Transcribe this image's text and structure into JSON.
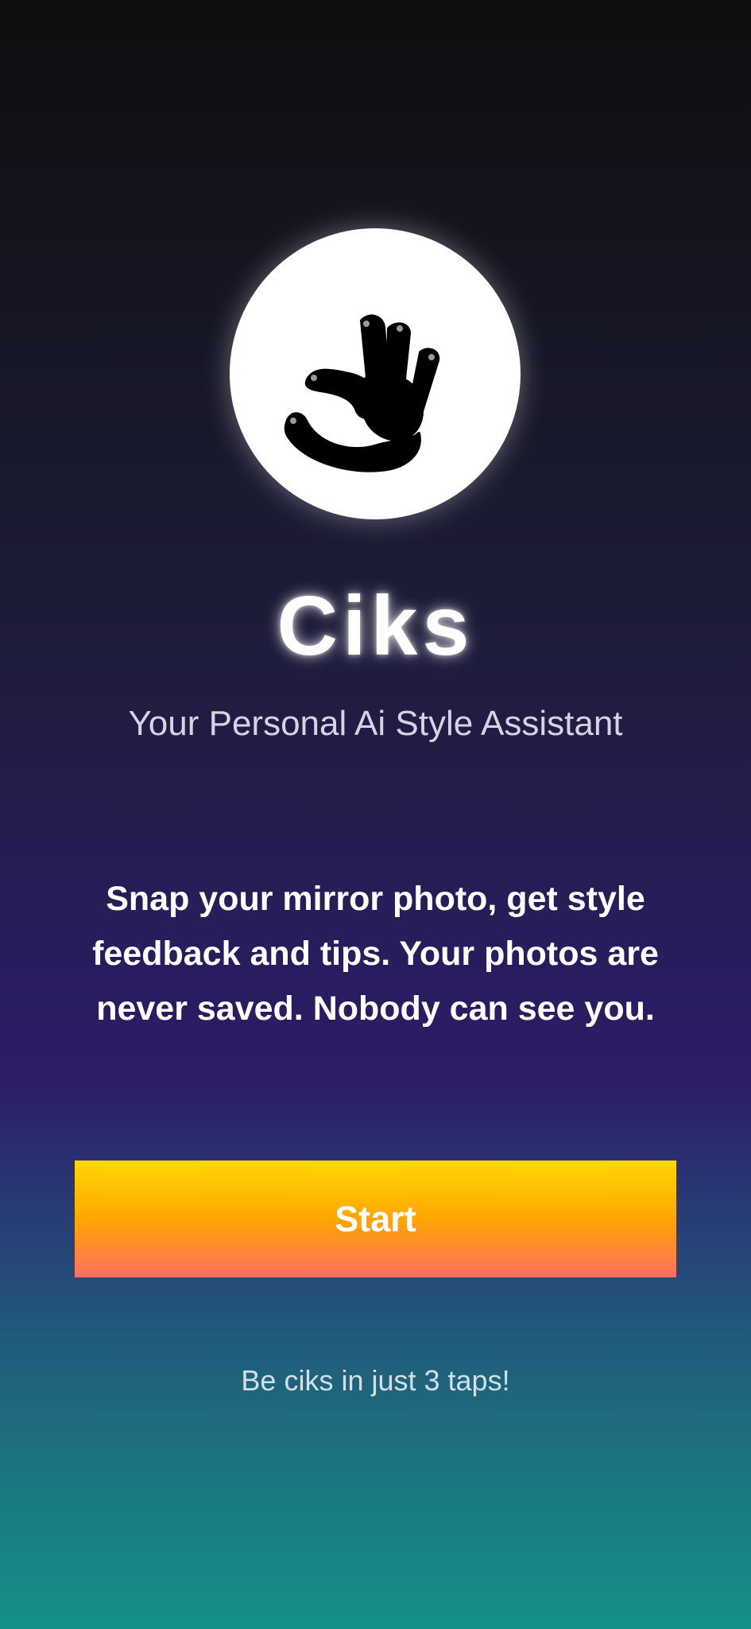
{
  "app": {
    "name": "Ciks",
    "tagline": "Your Personal Ai Style Assistant"
  },
  "intro": {
    "description": "Snap your mirror photo, get style feedback and tips. Your photos are never saved. Nobody can see you."
  },
  "actions": {
    "start_label": "Start"
  },
  "footer": {
    "note": "Be ciks in just 3 taps!"
  },
  "icons": {
    "logo": "ok-hand-icon"
  },
  "colors": {
    "button_gradient": [
      "#ffd800",
      "#ffa600",
      "#ff6e63"
    ],
    "background_top": "#0e0e10",
    "background_mid": "#2d1c67",
    "background_bottom": "#149089",
    "text_primary": "#ffffff"
  }
}
